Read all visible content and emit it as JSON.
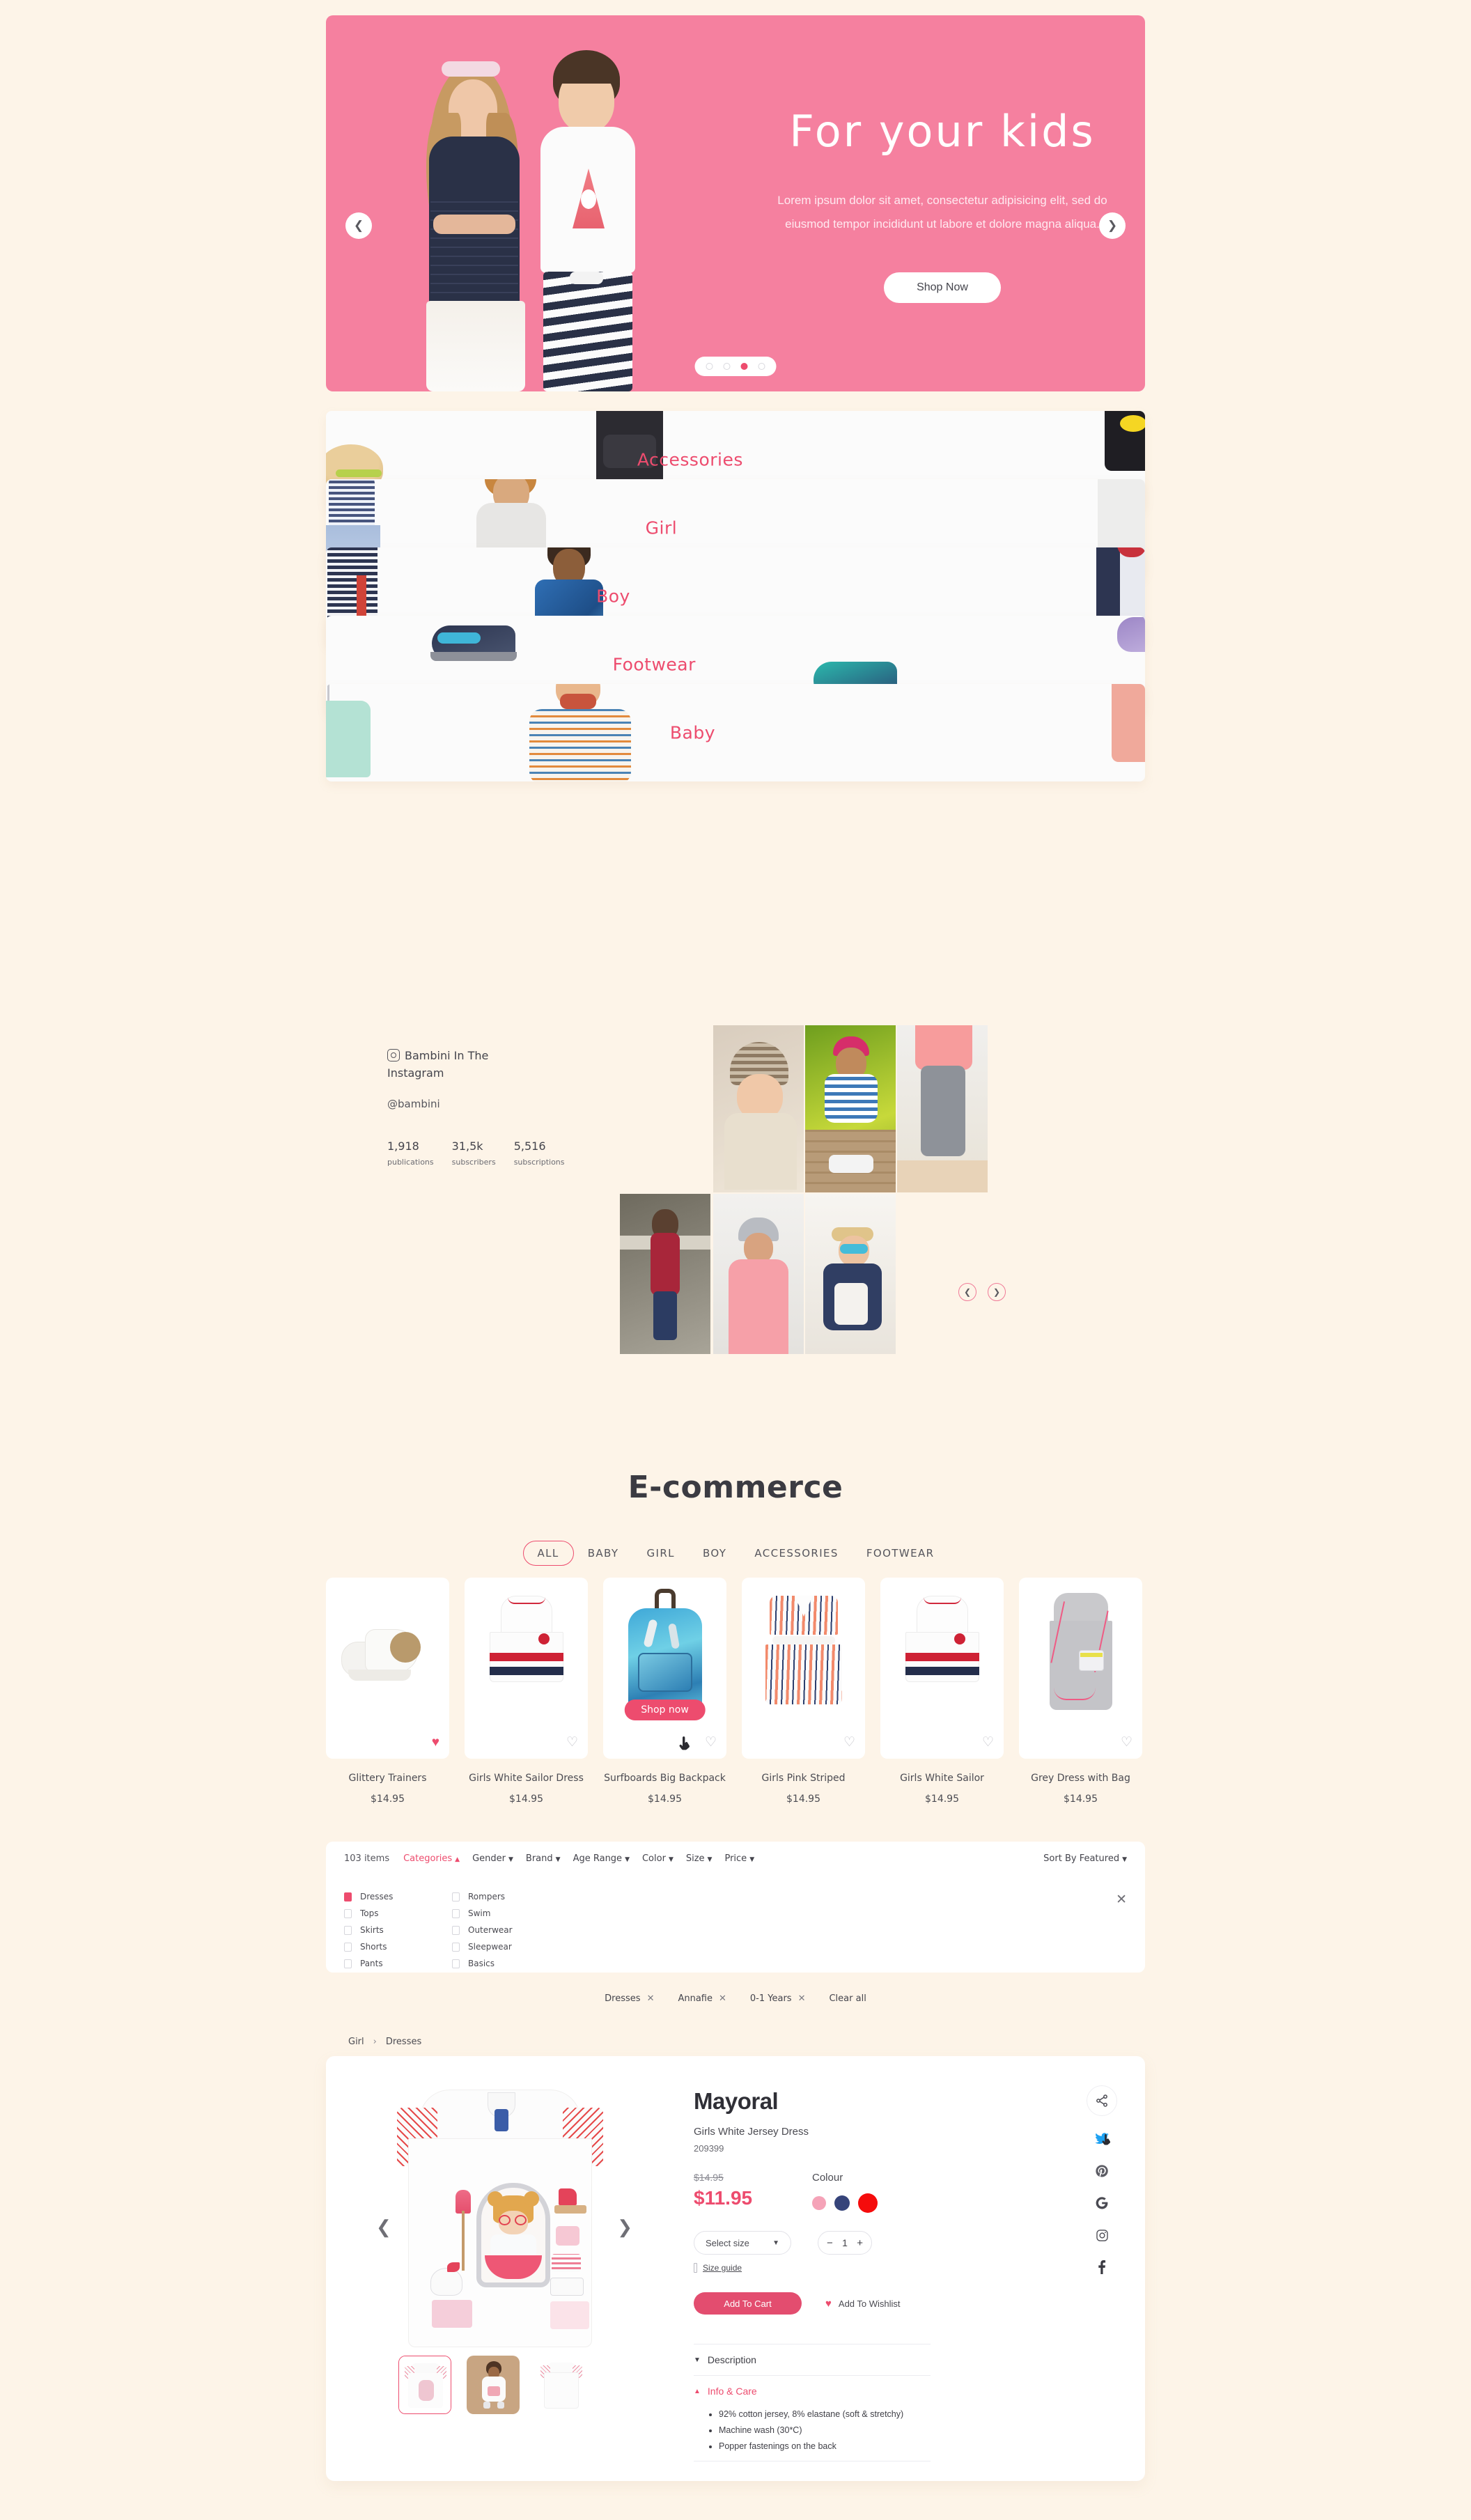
{
  "hero": {
    "title": "For your kids",
    "subtitle": "Lorem ipsum dolor sit amet, consectetur adipisicing elit, sed do eiusmod tempor incididunt ut labore et dolore magna aliqua.",
    "cta_label": "Shop Now",
    "prev_icon": "chevron-left-icon",
    "next_icon": "chevron-right-icon",
    "dots": 4,
    "active_dot": 3,
    "bg_color": "#F5809F"
  },
  "categories": [
    {
      "label": "Accessories",
      "label_left_pct": 38
    },
    {
      "label": "Girl",
      "label_left_pct": 39
    },
    {
      "label": "Boy",
      "label_left_pct": 33
    },
    {
      "label": "Footwear",
      "label_left_pct": 35
    },
    {
      "label": "Baby",
      "label_left_pct": 42
    }
  ],
  "instagram": {
    "icon": "instagram-icon",
    "title": "Bambini In The Instagram",
    "handle": "@bambini",
    "stats": [
      {
        "num": "1,918",
        "label": "publications"
      },
      {
        "num": "31,5k",
        "label": "subscribers"
      },
      {
        "num": "5,516",
        "label": "subscriptions"
      }
    ],
    "prev_icon": "chevron-left-icon",
    "next_icon": "chevron-right-icon"
  },
  "ecommerce": {
    "title": "E-commerce",
    "tabs": [
      "ALL",
      "BABY",
      "GIRL",
      "BOY",
      "ACCESSORIES",
      "FOOTWEAR"
    ],
    "active_tab": "ALL",
    "overlay_cta": "Shop now",
    "products": [
      {
        "name": "Glittery Trainers",
        "price": "$14.95",
        "wish": true
      },
      {
        "name": "Girls White Sailor Dress",
        "price": "$14.95",
        "wish": false
      },
      {
        "name": "Surfboards Big Backpack",
        "price": "$14.95",
        "wish": false,
        "hover": true
      },
      {
        "name": "Girls Pink Striped",
        "price": "$14.95",
        "wish": false
      },
      {
        "name": "Girls White Sailor",
        "price": "$14.95",
        "wish": false
      },
      {
        "name": "Grey Dress with Bag",
        "price": "$14.95",
        "wish": false
      }
    ]
  },
  "filters": {
    "count_label": "103 items",
    "items": [
      {
        "label": "Categories",
        "active": true,
        "caret": "up"
      },
      {
        "label": "Gender",
        "active": false,
        "caret": "down"
      },
      {
        "label": "Brand",
        "active": false,
        "caret": "down"
      },
      {
        "label": "Age Range",
        "active": false,
        "caret": "down"
      },
      {
        "label": "Color",
        "active": false,
        "caret": "down"
      },
      {
        "label": "Size",
        "active": false,
        "caret": "down"
      },
      {
        "label": "Price",
        "active": false,
        "caret": "down"
      }
    ],
    "sort_label": "Sort By Featured",
    "close_icon": "close-icon",
    "panel": {
      "col1": [
        {
          "label": "Dresses",
          "checked": true
        },
        {
          "label": "Tops",
          "checked": false
        },
        {
          "label": "Skirts",
          "checked": false
        },
        {
          "label": "Shorts",
          "checked": false
        },
        {
          "label": "Pants",
          "checked": false
        }
      ],
      "col2": [
        {
          "label": "Rompers",
          "checked": false
        },
        {
          "label": "Swim",
          "checked": false
        },
        {
          "label": "Outerwear",
          "checked": false
        },
        {
          "label": "Sleepwear",
          "checked": false
        },
        {
          "label": "Basics",
          "checked": false
        }
      ]
    },
    "chips": [
      "Dresses",
      "Annafie",
      "0-1 Years"
    ],
    "clear_all": "Clear all"
  },
  "detail": {
    "breadcrumb": {
      "parent": "Girl",
      "current": "Dresses"
    },
    "brand": "Mayoral",
    "product_name": "Girls White Jersey Dress",
    "sku": "209399",
    "old_price": "$14.95",
    "new_price": "$11.95",
    "colour_label": "Colour",
    "colours": [
      {
        "name": "pink",
        "hex": "#F5A3B8",
        "size": 20
      },
      {
        "name": "navy",
        "hex": "#36447A",
        "size": 22
      },
      {
        "name": "red",
        "hex": "#F50C0C",
        "size": 28
      }
    ],
    "size_placeholder": "Select size",
    "size_caret": "chevron-down-icon",
    "quantity": "1",
    "minus_label": "−",
    "plus_label": "+",
    "size_guide": "Size guide",
    "add_to_cart": "Add To Cart",
    "add_to_wishlist": "Add To Wishlist",
    "accordion": [
      {
        "label": "Description",
        "open": false,
        "items": []
      },
      {
        "label": "Info & Care",
        "open": true,
        "items": [
          "92% cotton jersey, 8% elastane (soft & stretchy)",
          "Machine wash (30*C)",
          "Popper fastenings on the back"
        ]
      }
    ],
    "social": [
      {
        "name": "share-icon"
      },
      {
        "name": "twitter-icon"
      },
      {
        "name": "pinterest-icon"
      },
      {
        "name": "google-icon"
      },
      {
        "name": "instagram-icon"
      },
      {
        "name": "facebook-icon"
      }
    ],
    "gallery_prev": "chevron-left-icon",
    "gallery_next": "chevron-right-icon"
  },
  "theme": {
    "page_bg": "#FDF4E8",
    "accent": "#ED4C6E",
    "card_bg": "#FFFFFF"
  }
}
